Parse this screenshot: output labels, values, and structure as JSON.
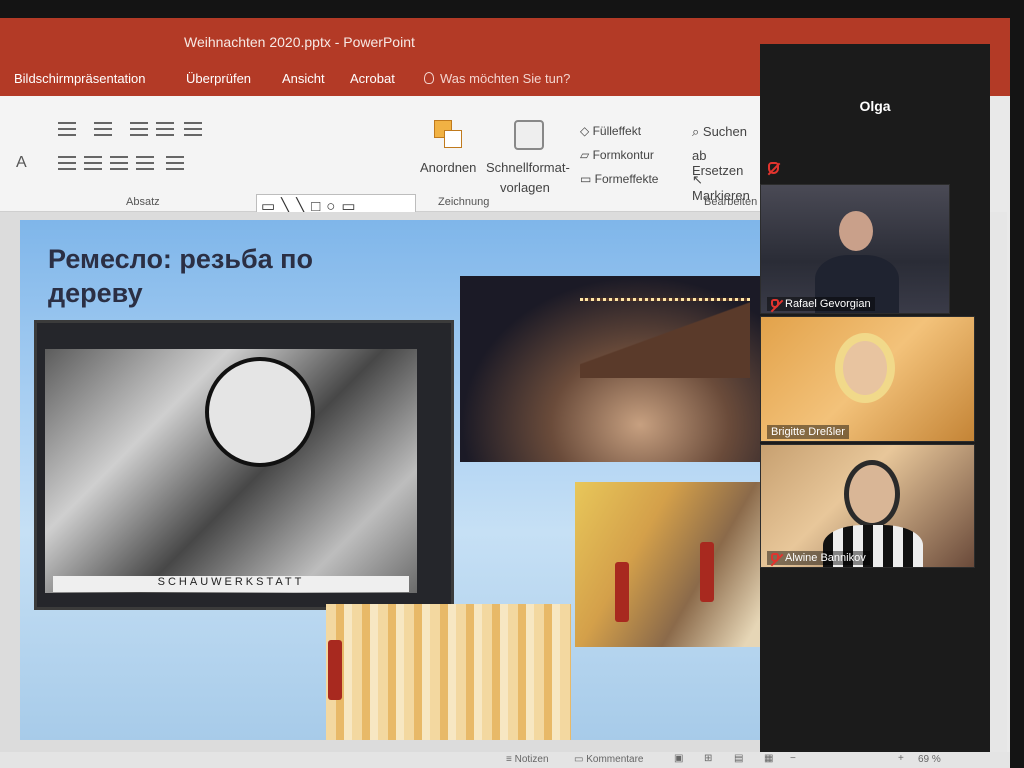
{
  "window": {
    "title": "Weihnachten 2020.pptx - PowerPoint"
  },
  "menu": {
    "items": [
      "Bildschirmpräsentation",
      "Überprüfen",
      "Ansicht",
      "Acrobat"
    ],
    "tell_me": "Was möchten Sie tun?"
  },
  "ribbon": {
    "groups": {
      "absatz": "Absatz",
      "zeichnung": "Zeichnung",
      "bearbeiten": "Bearbeiten"
    },
    "arrange": "Anordnen",
    "quick_styles_1": "Schnellformat-",
    "quick_styles_2": "vorlagen",
    "fill": "Fülleffekt",
    "outline": "Formkontur",
    "effects": "Formeffekte",
    "find": "Suchen",
    "replace": "Ersetzen",
    "select": "Markieren"
  },
  "slide": {
    "title_line1": "Ремесло: резьба по",
    "title_line2": "дереву",
    "workshop_caption": "SCHAUWERKSTATT"
  },
  "zoom": {
    "self_name": "Olga",
    "participants": [
      "Rafael Gevorgian",
      "Brigitte Dreßler",
      "Alwine Bannikov"
    ]
  },
  "status": {
    "notes": "Notizen",
    "comments": "Kommentare",
    "zoom_level": "69 %"
  }
}
